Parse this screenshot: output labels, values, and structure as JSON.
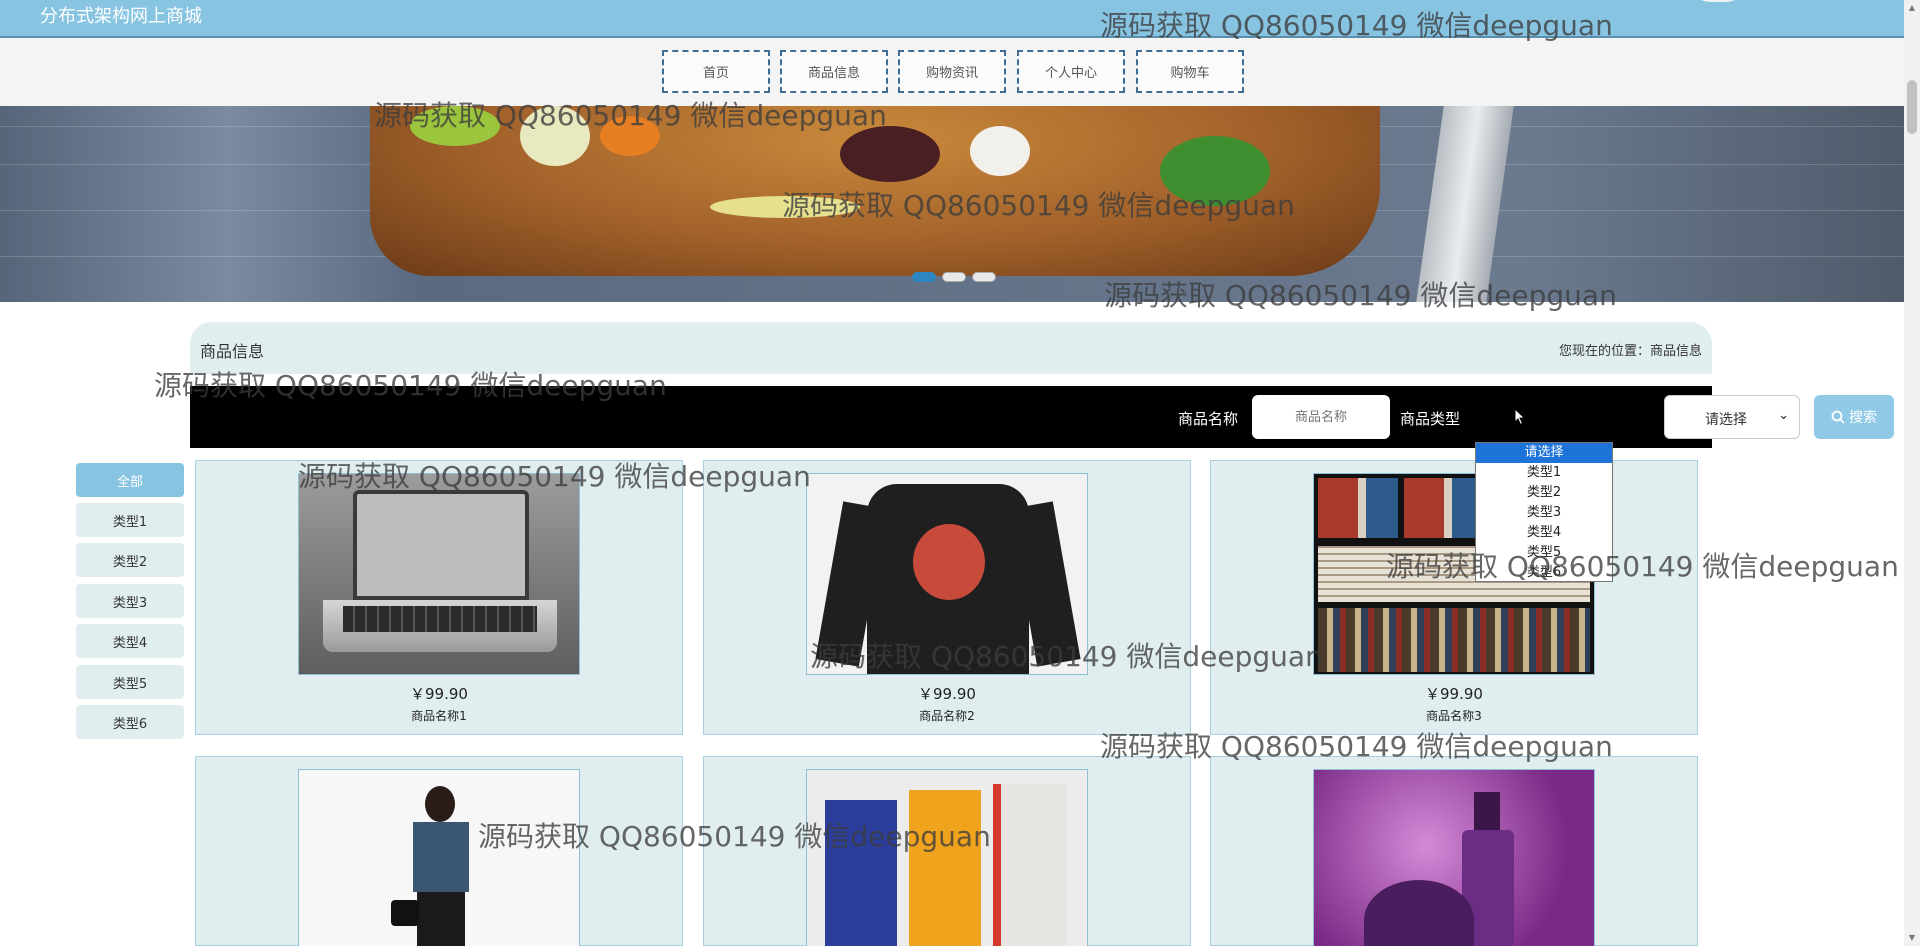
{
  "header": {
    "site_title": "分布式架构网上商城"
  },
  "nav": [
    {
      "label": "首页"
    },
    {
      "label": "商品信息"
    },
    {
      "label": "购物资讯"
    },
    {
      "label": "个人中心"
    },
    {
      "label": "购物车"
    }
  ],
  "banner": {
    "slide_count": 3,
    "active_slide": 1
  },
  "section": {
    "title": "商品信息",
    "breadcrumb_prefix": "您现在的位置：",
    "breadcrumb_current": "商品信息"
  },
  "search": {
    "name_label": "商品名称",
    "name_placeholder": "商品名称",
    "type_label": "商品类型",
    "type_selected": "请选择",
    "button_label": "搜索"
  },
  "dropdown": {
    "options": [
      "请选择",
      "类型1",
      "类型2",
      "类型3",
      "类型4",
      "类型5",
      "类型6"
    ],
    "highlighted": "请选择"
  },
  "categories": [
    {
      "label": "全部",
      "active": true
    },
    {
      "label": "类型1"
    },
    {
      "label": "类型2"
    },
    {
      "label": "类型3"
    },
    {
      "label": "类型4"
    },
    {
      "label": "类型5"
    },
    {
      "label": "类型6"
    }
  ],
  "products": [
    {
      "price": "￥99.90",
      "name": "商品名称1",
      "image": "laptop"
    },
    {
      "price": "￥99.90",
      "name": "商品名称2",
      "image": "sweatshirt"
    },
    {
      "price": "￥99.90",
      "name": "商品名称3",
      "image": "bookshelf"
    },
    {
      "price": "",
      "name": "",
      "image": "fashion-model"
    },
    {
      "price": "",
      "name": "",
      "image": "milk-cartons"
    },
    {
      "price": "",
      "name": "",
      "image": "cosmetics"
    }
  ],
  "watermark_text": "源码获取 QQ86050149 微信deepguan",
  "colors": {
    "topbar": "#87c4e2",
    "panel": "#e1eef0",
    "accent": "#2e86c1",
    "search_bar": "#000000"
  }
}
